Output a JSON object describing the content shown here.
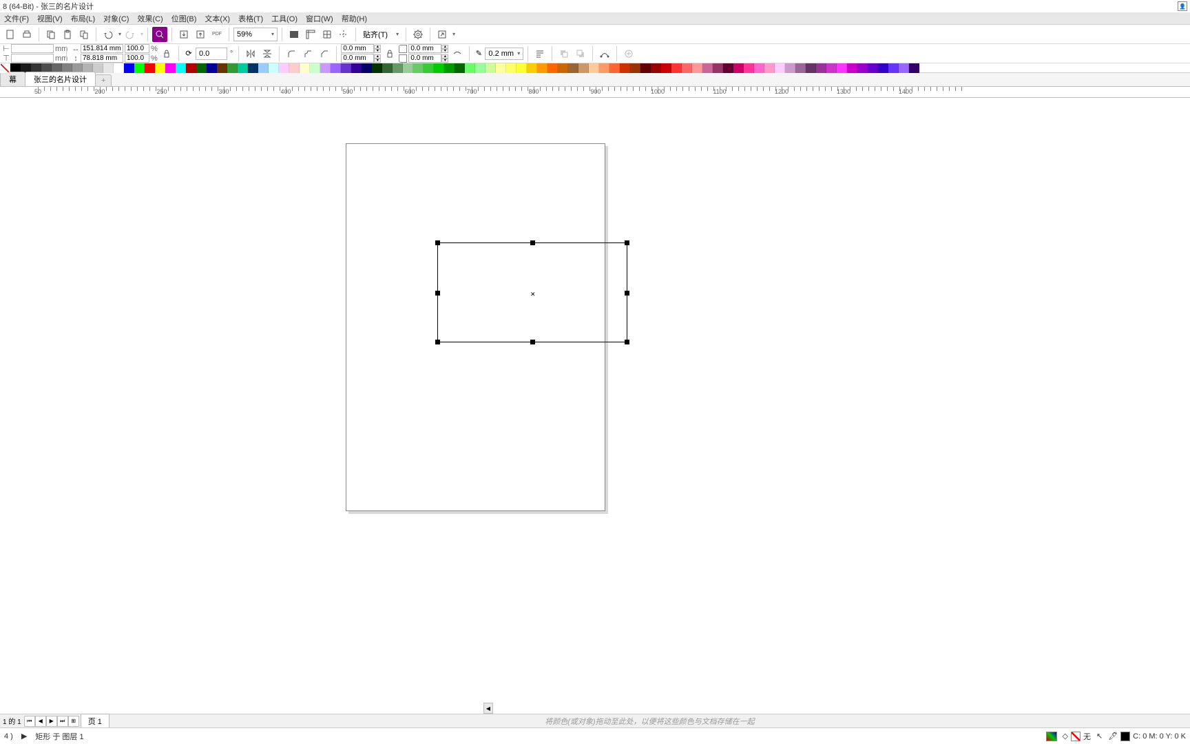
{
  "title": "8 (64-Bit) - 张三的名片设计",
  "menu": {
    "file": "文件(F)",
    "view": "视图(V)",
    "layout": "布局(L)",
    "object": "对象(C)",
    "effect": "效果(C)",
    "bitmap": "位图(B)",
    "text": "文本(X)",
    "table": "表格(T)",
    "tool": "工具(O)",
    "window": "窗口(W)",
    "help": "帮助(H)"
  },
  "toolbar": {
    "zoom": "59%",
    "snap": "贴齐(T)"
  },
  "prop": {
    "x": "",
    "y": "",
    "w": "151.814 mm",
    "h": "78.818 mm",
    "sx": "100.0",
    "sy": "100.0",
    "angle": "0.0",
    "corner_tl": "0.0 mm",
    "corner_tr": "0.0 mm",
    "corner_bl": "0.0 mm",
    "corner_br": "0.0 mm",
    "outline": "0.2 mm",
    "unit": "mm",
    "pct": "%"
  },
  "doctabs": {
    "t1": "幕",
    "t2": "张三的名片设计",
    "add": "+"
  },
  "ruler_labels": [
    "50",
    "200",
    "250",
    "300",
    "400",
    "500",
    "600",
    "700",
    "800",
    "900",
    "1000",
    "1100",
    "1200",
    "1300",
    "1400"
  ],
  "pagenav": {
    "count": "1 的 1",
    "page": "页 1"
  },
  "hint": "将颜色(或对象)拖动至此处，以便将这些颜色与文档存储在一起",
  "status": {
    "left1": "4 )",
    "left2": "▶",
    "sel": "矩形 于 图层 1",
    "fill": "无",
    "cmyk": "C: 0 M: 0 Y: 0 K"
  },
  "colors": [
    "none",
    "#000000",
    "#1a1a1a",
    "#333333",
    "#4d4d4d",
    "#666666",
    "#808080",
    "#999999",
    "#b3b3b3",
    "#cccccc",
    "#e6e6e6",
    "#ffffff",
    "#0000ff",
    "#00ff00",
    "#ff0000",
    "#ffff00",
    "#ff00ff",
    "#00ffff",
    "#b30000",
    "#006600",
    "#000099",
    "#663300",
    "#339933",
    "#00cc99",
    "#003366",
    "#99ccff",
    "#ccffff",
    "#ffccff",
    "#ffcccc",
    "#ffffcc",
    "#ccffcc",
    "#cc99ff",
    "#9966ff",
    "#6633cc",
    "#330099",
    "#000066",
    "#003300",
    "#336633",
    "#669966",
    "#99cc99",
    "#66cc66",
    "#33cc33",
    "#00cc00",
    "#009900",
    "#006600",
    "#66ff66",
    "#99ff99",
    "#ccff99",
    "#ffff99",
    "#ffff66",
    "#ffff33",
    "#ffcc00",
    "#ff9900",
    "#ff6600",
    "#cc6600",
    "#996633",
    "#cc9966",
    "#ffcc99",
    "#ff9966",
    "#ff6633",
    "#cc3300",
    "#993300",
    "#660000",
    "#990000",
    "#cc0000",
    "#ff3333",
    "#ff6666",
    "#ff9999",
    "#cc6699",
    "#993366",
    "#660033",
    "#cc0066",
    "#ff3399",
    "#ff66cc",
    "#ff99cc",
    "#ffccff",
    "#cc99cc",
    "#996699",
    "#663366",
    "#993399",
    "#cc33cc",
    "#ff33ff",
    "#cc00cc",
    "#9900cc",
    "#6600cc",
    "#3300cc",
    "#6633ff",
    "#9966ff",
    "#330066"
  ]
}
